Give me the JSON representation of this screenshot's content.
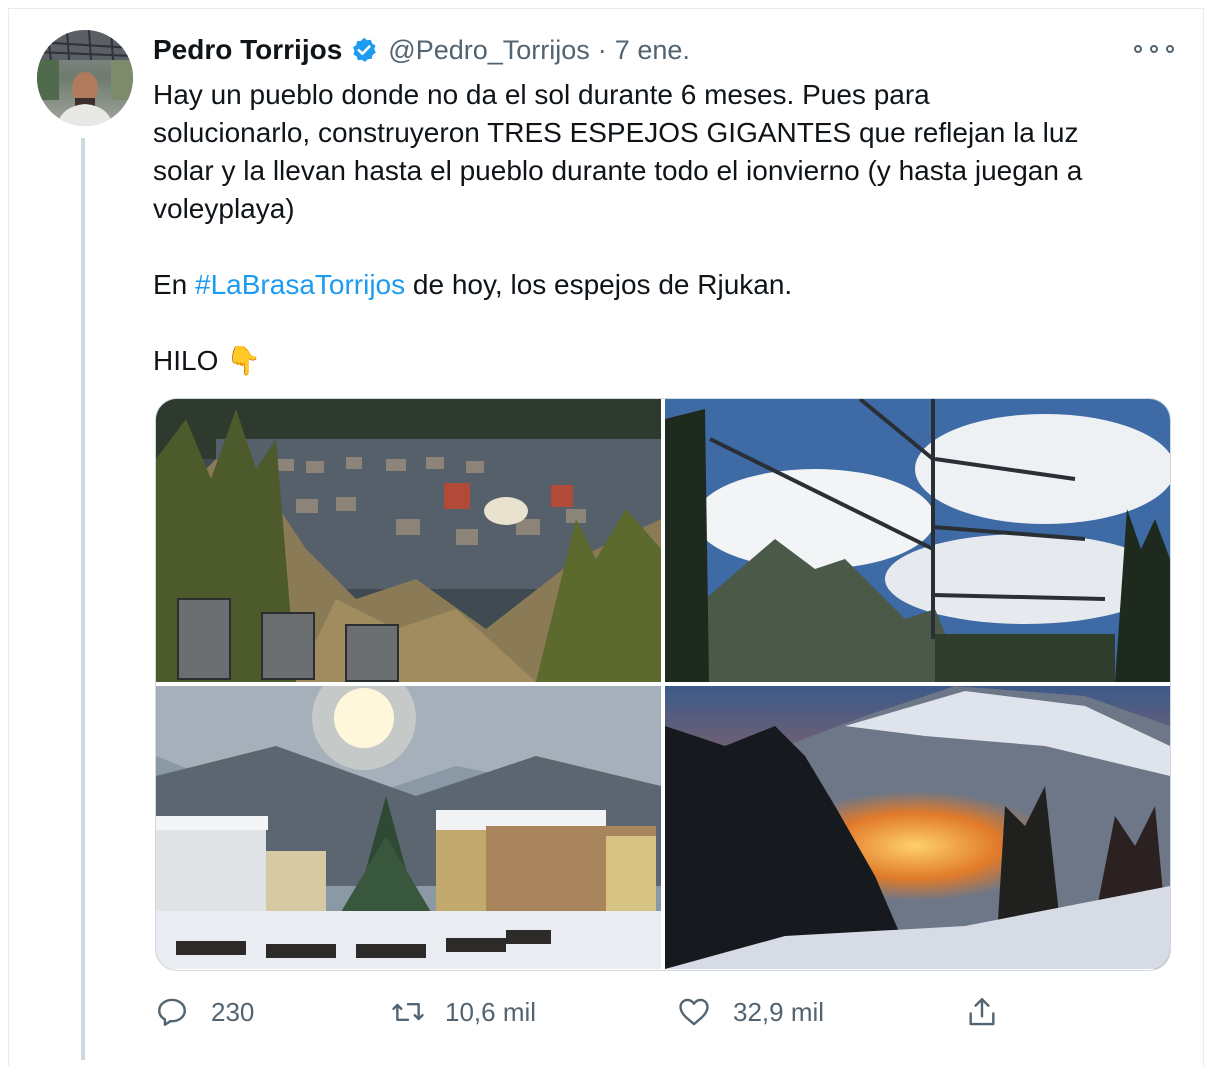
{
  "tweet": {
    "author_name": "Pedro Torrijos",
    "author_handle": "@Pedro_Torrijos",
    "separator": "·",
    "date": "7 ene.",
    "text_lines": [
      "Hay un pueblo donde no da el sol durante 6 meses. Pues  para",
      "solucionarlo, construyeron TRES ESPEJOS GIGANTES que reflejan la luz",
      "solar y la llevan hasta el pueblo durante todo el ionvierno (y hasta juegan a",
      "voleyplaya)"
    ],
    "line2_prefix": "En ",
    "hashtag": "#LaBrasaTorrijos",
    "line2_suffix": " de hoy, los espejos de Rjukan.",
    "thread_label": "HILO",
    "thread_emoji": "👇"
  },
  "stats": {
    "replies": "230",
    "retweets": "10,6 mil",
    "likes": "32,9 mil"
  },
  "icons": {
    "verified": "verified-badge-icon",
    "more": "more-options-icon",
    "reply": "reply-icon",
    "retweet": "retweet-icon",
    "like": "heart-icon",
    "share": "share-icon"
  },
  "colors": {
    "accent": "#1d9bf0",
    "secondary_text": "#536471",
    "thread_line": "#cfd9de"
  }
}
